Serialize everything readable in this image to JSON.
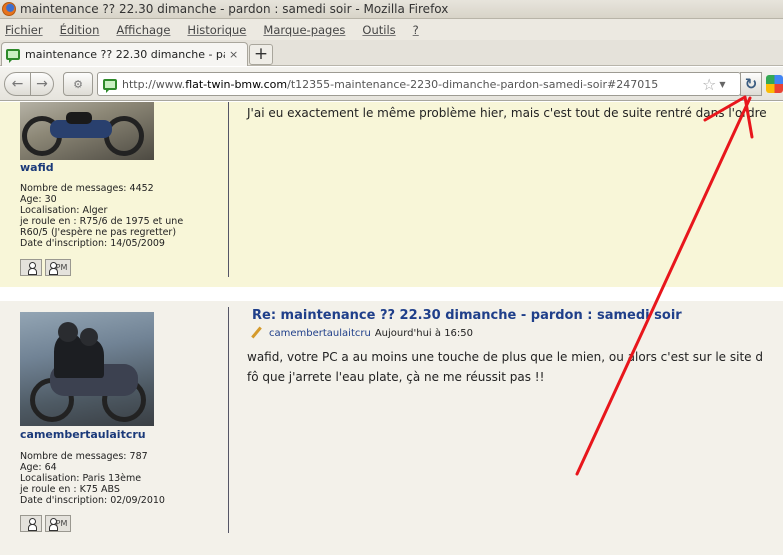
{
  "window": {
    "title": "maintenance ?? 22.30 dimanche - pardon : samedi soir - Mozilla Firefox"
  },
  "menu": [
    "Fichier",
    "Édition",
    "Affichage",
    "Historique",
    "Marque-pages",
    "Outils",
    "?"
  ],
  "tab": {
    "label": "maintenance ?? 22.30 dimanche - pardon : s...",
    "close": "×",
    "new_tab": "+"
  },
  "nav": {
    "url_prefix": "http://www.",
    "url_domain": "flat-twin-bmw.com",
    "url_path": "/t12355-maintenance-2230-dimanche-pardon-samedi-soir#247015",
    "reload_glyph": "↻"
  },
  "posts": [
    {
      "username": "wafid",
      "info": [
        "Nombre de messages: 4452",
        "Age: 30",
        "Localisation: Alger",
        "je roule en : R75/6 de 1975 et une R60/5 (J'espère ne pas regretter)",
        "Date d'inscription: 14/05/2009"
      ],
      "body": "J'ai eu exactement le même problème hier, mais c'est tout de suite rentré dans l'ordre"
    },
    {
      "username": "camembertaulaitcru",
      "info": [
        "Nombre de messages: 787",
        "Age: 64",
        "Localisation: Paris 13ème",
        "je roule en : K75 ABS",
        "Date d'inscription: 02/09/2010"
      ],
      "title": "Re: maintenance ?? 22.30 dimanche - pardon : samedi soir",
      "meta_author": "camembertaulaitcru",
      "meta_date": "Aujourd'hui à 16:50",
      "body_lines": [
        "wafid, votre PC a au moins une touche de plus que le mien, ou alors c'est sur le site d",
        "fô que j'arrete l'eau plate, çà ne me réussit pas !!"
      ]
    }
  ],
  "profile_buttons": {
    "pm_label": "PM"
  },
  "annotation_color": "#e8161c"
}
